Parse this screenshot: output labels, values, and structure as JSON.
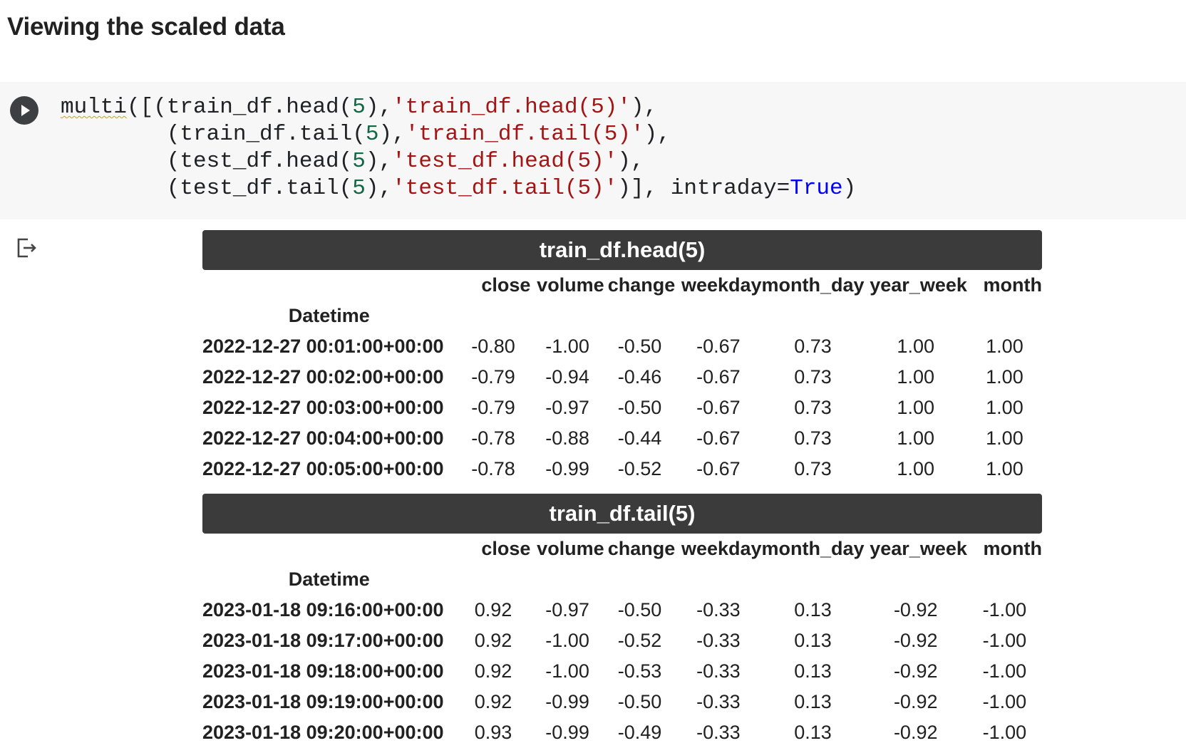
{
  "section_heading": "Viewing the scaled data",
  "code_cell": {
    "lines": [
      [
        [
          "fn",
          "multi"
        ],
        [
          "p",
          "([(train_df.head("
        ],
        [
          "num",
          "5"
        ],
        [
          "p",
          "),"
        ],
        [
          "str",
          "'train_df.head(5)'"
        ],
        [
          "p",
          "),"
        ]
      ],
      [
        [
          "p",
          "        (train_df.tail("
        ],
        [
          "num",
          "5"
        ],
        [
          "p",
          "),"
        ],
        [
          "str",
          "'train_df.tail(5)'"
        ],
        [
          "p",
          "),"
        ]
      ],
      [
        [
          "p",
          "        (test_df.head("
        ],
        [
          "num",
          "5"
        ],
        [
          "p",
          "),"
        ],
        [
          "str",
          "'test_df.head(5)'"
        ],
        [
          "p",
          "),"
        ]
      ],
      [
        [
          "p",
          "        (test_df.tail("
        ],
        [
          "num",
          "5"
        ],
        [
          "p",
          "),"
        ],
        [
          "str",
          "'test_df.tail(5)'"
        ],
        [
          "p",
          ")], intraday="
        ],
        [
          "kw",
          "True"
        ],
        [
          "p",
          ")"
        ]
      ]
    ]
  },
  "outputs": [
    {
      "title": "train_df.head(5)",
      "columns": [
        "close",
        "volume",
        "change",
        "weekday",
        "month_day",
        "year_week",
        "month"
      ],
      "index_name": "Datetime",
      "rows": [
        {
          "index": "2022-12-27 00:01:00+00:00",
          "values": [
            "-0.80",
            "-1.00",
            "-0.50",
            "-0.67",
            "0.73",
            "1.00",
            "1.00"
          ]
        },
        {
          "index": "2022-12-27 00:02:00+00:00",
          "values": [
            "-0.79",
            "-0.94",
            "-0.46",
            "-0.67",
            "0.73",
            "1.00",
            "1.00"
          ]
        },
        {
          "index": "2022-12-27 00:03:00+00:00",
          "values": [
            "-0.79",
            "-0.97",
            "-0.50",
            "-0.67",
            "0.73",
            "1.00",
            "1.00"
          ]
        },
        {
          "index": "2022-12-27 00:04:00+00:00",
          "values": [
            "-0.78",
            "-0.88",
            "-0.44",
            "-0.67",
            "0.73",
            "1.00",
            "1.00"
          ]
        },
        {
          "index": "2022-12-27 00:05:00+00:00",
          "values": [
            "-0.78",
            "-0.99",
            "-0.52",
            "-0.67",
            "0.73",
            "1.00",
            "1.00"
          ]
        }
      ]
    },
    {
      "title": "train_df.tail(5)",
      "columns": [
        "close",
        "volume",
        "change",
        "weekday",
        "month_day",
        "year_week",
        "month"
      ],
      "index_name": "Datetime",
      "rows": [
        {
          "index": "2023-01-18 09:16:00+00:00",
          "values": [
            "0.92",
            "-0.97",
            "-0.50",
            "-0.33",
            "0.13",
            "-0.92",
            "-1.00"
          ]
        },
        {
          "index": "2023-01-18 09:17:00+00:00",
          "values": [
            "0.92",
            "-1.00",
            "-0.52",
            "-0.33",
            "0.13",
            "-0.92",
            "-1.00"
          ]
        },
        {
          "index": "2023-01-18 09:18:00+00:00",
          "values": [
            "0.92",
            "-1.00",
            "-0.53",
            "-0.33",
            "0.13",
            "-0.92",
            "-1.00"
          ]
        },
        {
          "index": "2023-01-18 09:19:00+00:00",
          "values": [
            "0.92",
            "-0.99",
            "-0.50",
            "-0.33",
            "0.13",
            "-0.92",
            "-1.00"
          ]
        },
        {
          "index": "2023-01-18 09:20:00+00:00",
          "values": [
            "0.93",
            "-0.99",
            "-0.49",
            "-0.33",
            "0.13",
            "-0.92",
            "-1.00"
          ]
        }
      ]
    }
  ]
}
